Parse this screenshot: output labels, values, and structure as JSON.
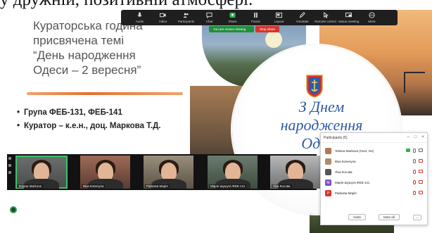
{
  "caption": "у дружній, позитивній атмосфері.",
  "slide": {
    "title_lines": [
      "Кураторська година",
      "присвячена темі",
      "“День народження",
      "Одеси – 2 вересня”"
    ],
    "bullets": [
      "Група ФЕБ-131, ФЕБ-141",
      "Куратор – к.е.н., доц. Маркова Т.Д."
    ],
    "greeting_lines": [
      "З Днем",
      "народження",
      "Одеси"
    ]
  },
  "toolbar": {
    "items": [
      {
        "label": "Audio",
        "icon": "microphone-icon"
      },
      {
        "label": "Video",
        "icon": "video-camera-icon"
      },
      {
        "label": "Participants",
        "icon": "participants-icon",
        "count": "5"
      },
      {
        "label": "Chat",
        "icon": "chat-icon"
      },
      {
        "label": "Share",
        "icon": "share-screen-icon"
      },
      {
        "label": "Pause",
        "icon": "pause-icon"
      },
      {
        "label": "Layout",
        "icon": "layout-icon"
      },
      {
        "label": "Annotate",
        "icon": "annotate-icon"
      },
      {
        "label": "Remote control",
        "icon": "remote-control-icon"
      },
      {
        "label": "Vasue meeting",
        "icon": "meeting-icon"
      },
      {
        "label": "More",
        "icon": "more-icon"
      }
    ],
    "sharing_text": "You are screen sharing",
    "stop_text": "Stop share",
    "accent": "#2fb24a",
    "stop_color": "#d9332b"
  },
  "video_strip": [
    {
      "name": "Tetiana Markova"
    },
    {
      "name": "Віка Копичуна"
    },
    {
      "name": "Райкова Марія"
    },
    {
      "name": "Марія Шушуга ФЕБ-141"
    },
    {
      "name": "Ліза Косова"
    }
  ],
  "participants_panel": {
    "title": "Participants (5)",
    "rows": [
      {
        "name": "Tetiana Markova (Host, me)",
        "avatar_color": "#b07a55",
        "avatar_letter": "",
        "mic": "on",
        "cam": "on"
      },
      {
        "name": "Віка Копичуна",
        "avatar_color": "#b08a6a",
        "avatar_letter": "",
        "mic": "on",
        "cam": "off"
      },
      {
        "name": "Ліза Косова",
        "avatar_color": "#555555",
        "avatar_letter": "",
        "mic": "off",
        "cam": "off"
      },
      {
        "name": "Марія Шушуга ФЕБ-141",
        "avatar_color": "#7b4fc9",
        "avatar_letter": "М",
        "mic": "off",
        "cam": "off"
      },
      {
        "name": "Райкова Марія",
        "avatar_color": "#d9332b",
        "avatar_letter": "Р",
        "mic": "off",
        "cam": "off"
      }
    ],
    "invite_label": "Invite",
    "mute_all_label": "Mute all",
    "more_label": "..."
  }
}
